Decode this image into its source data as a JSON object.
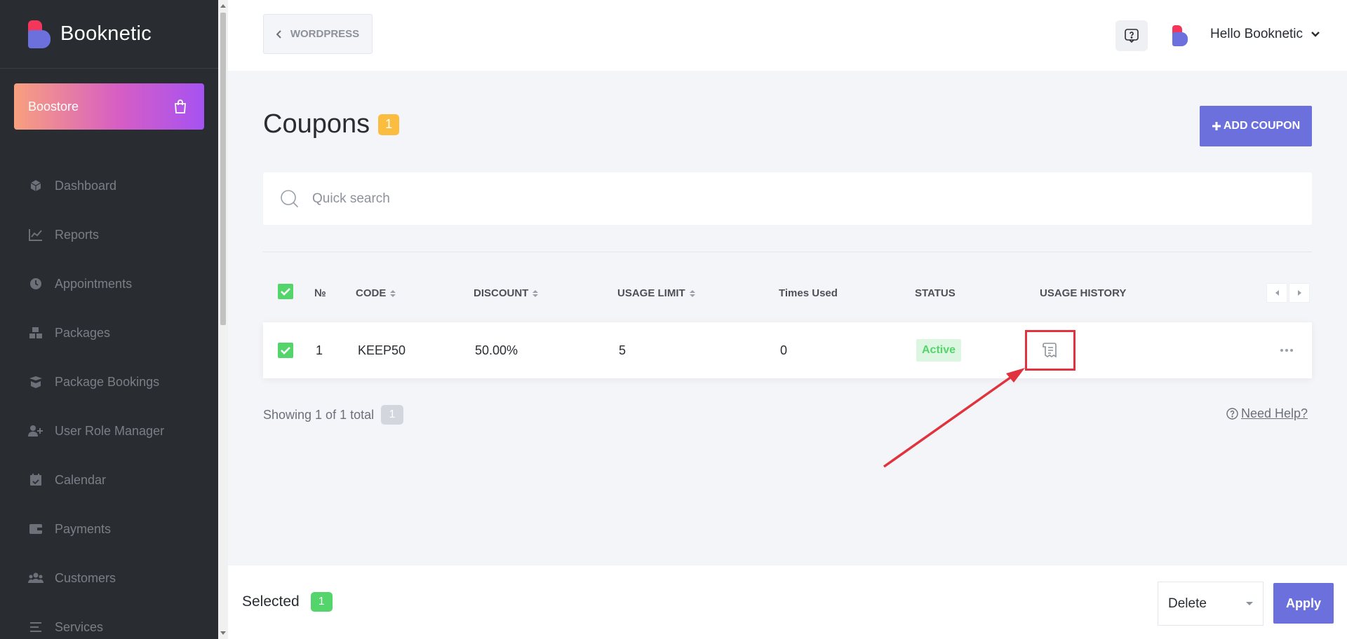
{
  "brand": {
    "name": "Booknetic"
  },
  "boostore": {
    "label": "Boostore",
    "icon": "shopping-bag-icon"
  },
  "sidebar": {
    "items": [
      {
        "label": "Dashboard",
        "icon": "cube-icon"
      },
      {
        "label": "Reports",
        "icon": "chart-line-icon"
      },
      {
        "label": "Appointments",
        "icon": "clock-icon"
      },
      {
        "label": "Packages",
        "icon": "boxes-icon"
      },
      {
        "label": "Package Bookings",
        "icon": "box-open-icon"
      },
      {
        "label": "User Role Manager",
        "icon": "user-plus-icon"
      },
      {
        "label": "Calendar",
        "icon": "calendar-check-icon"
      },
      {
        "label": "Payments",
        "icon": "wallet-icon"
      },
      {
        "label": "Customers",
        "icon": "users-icon"
      },
      {
        "label": "Services",
        "icon": "list-icon"
      }
    ]
  },
  "header": {
    "back_label": "WORDPRESS",
    "user_greeting": "Hello Booknetic"
  },
  "page": {
    "title": "Coupons",
    "count": "1",
    "add_button": "ADD COUPON"
  },
  "search": {
    "placeholder": "Quick search",
    "value": ""
  },
  "table": {
    "headers": {
      "no": "№",
      "code": "CODE",
      "discount": "DISCOUNT",
      "usage_limit": "USAGE LIMIT",
      "times_used": "Times Used",
      "status": "STATUS",
      "usage_history": "USAGE HISTORY"
    },
    "rows": [
      {
        "no": "1",
        "code": "KEEP50",
        "discount": "50.00%",
        "usage_limit": "5",
        "times_used": "0",
        "status": "Active",
        "checked": true
      }
    ]
  },
  "footer": {
    "showing": "Showing 1 of 1 total",
    "total": "1",
    "need_help": "Need Help?"
  },
  "bulk": {
    "selected_label": "Selected",
    "selected_count": "1",
    "action": "Delete",
    "apply": "Apply"
  },
  "colors": {
    "accent": "#6c70dc",
    "sidebar_bg": "#292d32",
    "success": "#53d56c",
    "warning": "#fbbd3f",
    "annotation": "#e0333d"
  }
}
